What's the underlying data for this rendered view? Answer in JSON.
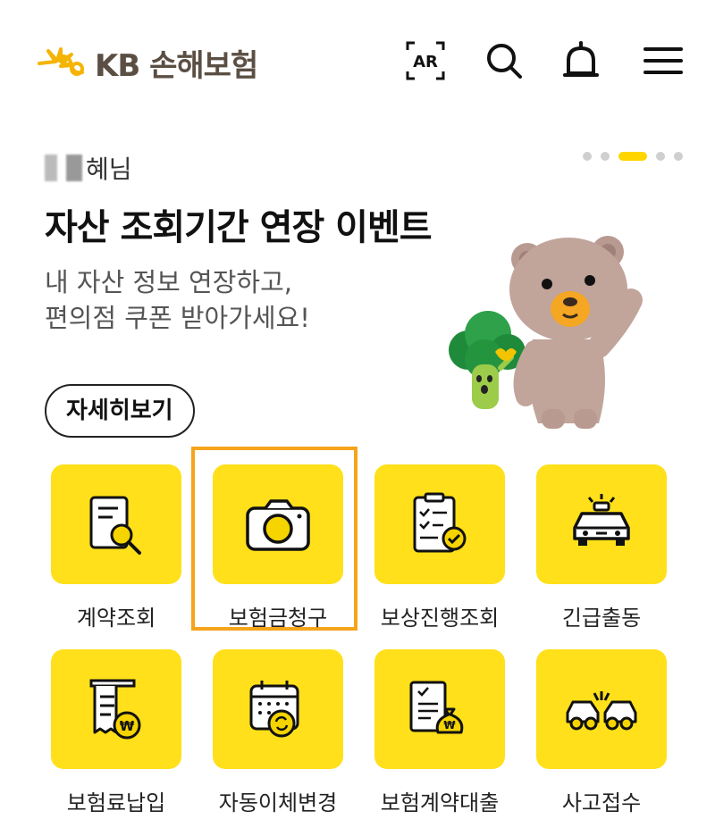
{
  "header": {
    "logo_text": "KB 손해보험",
    "icons": [
      "ar-icon",
      "search-icon",
      "bell-icon",
      "menu-icon"
    ]
  },
  "banner": {
    "greeting_suffix": "혜님",
    "title": "자산 조회기간 연장 이벤트",
    "desc_line1": "내 자산 정보 연장하고,",
    "desc_line2": "편의점 쿠폰 받아가세요!",
    "detail_button": "자세히보기",
    "pager": {
      "total": 5,
      "active_index": 2
    }
  },
  "menu": [
    {
      "label": "계약조회",
      "icon": "contract-search-icon"
    },
    {
      "label": "보험금청구",
      "icon": "camera-icon"
    },
    {
      "label": "보상진행조회",
      "icon": "clipboard-check-icon"
    },
    {
      "label": "긴급출동",
      "icon": "emergency-car-icon"
    },
    {
      "label": "보험료납입",
      "icon": "receipt-won-icon"
    },
    {
      "label": "자동이체변경",
      "icon": "calendar-refresh-icon"
    },
    {
      "label": "보험계약대출",
      "icon": "document-moneybag-icon"
    },
    {
      "label": "사고접수",
      "icon": "car-accident-icon"
    }
  ],
  "colors": {
    "accent": "#ffe01a",
    "highlight": "#f6a41b",
    "logo": "#5b4f44",
    "logo_star": "#f5b400"
  }
}
